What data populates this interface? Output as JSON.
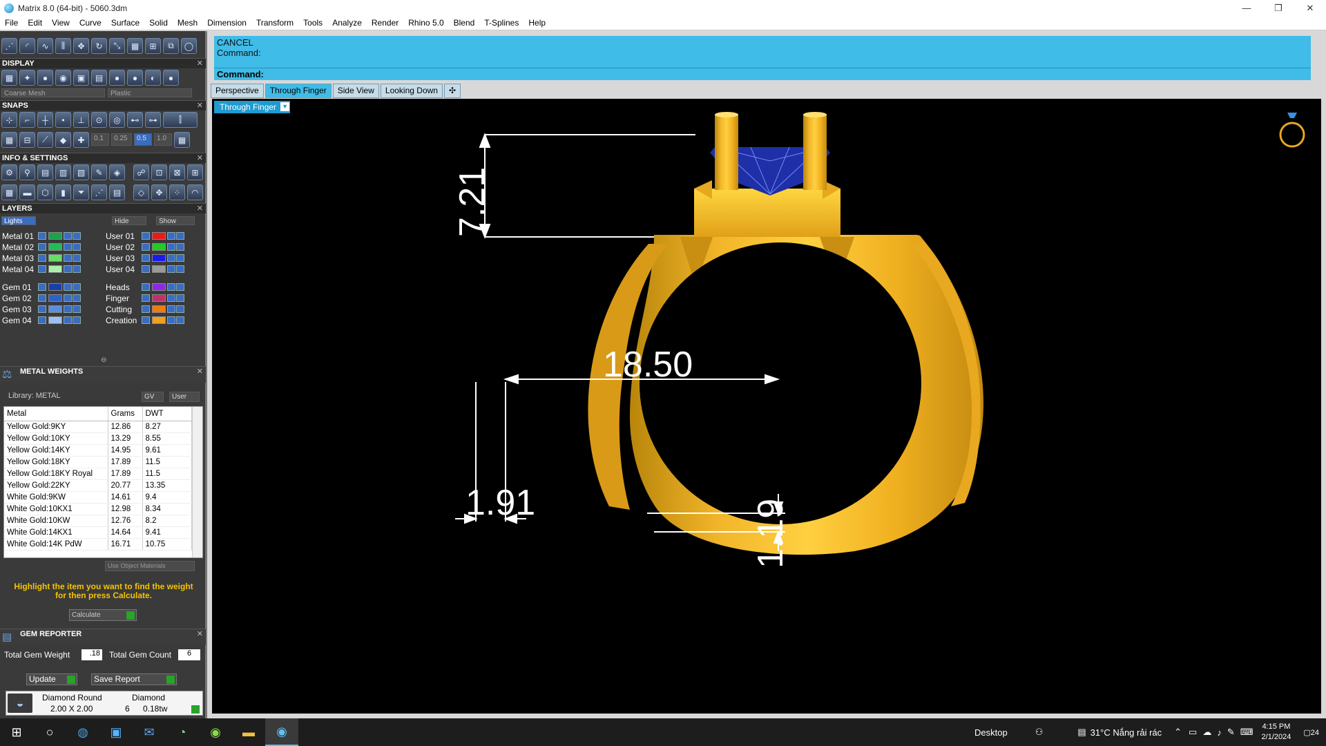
{
  "window": {
    "title": "Matrix 8.0 (64-bit) - 5060.3dm",
    "controls": [
      "—",
      "❐",
      "✕"
    ]
  },
  "menu": [
    "File",
    "Edit",
    "View",
    "Curve",
    "Surface",
    "Solid",
    "Mesh",
    "Dimension",
    "Transform",
    "Tools",
    "Analyze",
    "Render",
    "Rhino 5.0",
    "Blend",
    "T-Splines",
    "Help"
  ],
  "display": {
    "header": "DISPLAY",
    "mesh_select": "Coarse Mesh",
    "material_select": "Plastic"
  },
  "snaps": {
    "header": "SNAPS",
    "values": [
      "0.1",
      "0.25",
      "0.5",
      "1.0"
    ]
  },
  "info": {
    "header": "INFO & SETTINGS"
  },
  "layers": {
    "header": "LAYERS",
    "lights": "Lights",
    "hide": "Hide",
    "show": "Show",
    "left": [
      {
        "name": "Metal 01",
        "color": "#1aa34a"
      },
      {
        "name": "Metal 02",
        "color": "#22bb55"
      },
      {
        "name": "Metal 03",
        "color": "#66dd66"
      },
      {
        "name": "Metal 04",
        "color": "#aaf0aa"
      },
      {
        "name": "Gem 01",
        "color": "#1a3fa8"
      },
      {
        "name": "Gem 02",
        "color": "#2f62c9"
      },
      {
        "name": "Gem 03",
        "color": "#5a8fe0"
      },
      {
        "name": "Gem 04",
        "color": "#9ec0f0"
      }
    ],
    "right": [
      {
        "name": "User 01",
        "color": "#e61b1b"
      },
      {
        "name": "User 02",
        "color": "#22cc22"
      },
      {
        "name": "User 03",
        "color": "#1a1aee"
      },
      {
        "name": "User 04",
        "color": "#9a9a9a"
      },
      {
        "name": "Heads",
        "color": "#8a2be2"
      },
      {
        "name": "Finger",
        "color": "#c0306a"
      },
      {
        "name": "Cutting",
        "color": "#f07a10"
      },
      {
        "name": "Creation",
        "color": "#f0a020"
      }
    ]
  },
  "weights": {
    "header": "METAL WEIGHTS",
    "library": "Library: METAL",
    "gv": "GV",
    "user": "User",
    "columns": [
      "Metal",
      "Grams",
      "DWT"
    ],
    "rows": [
      [
        "Yellow Gold:9KY",
        "12.86",
        "8.27"
      ],
      [
        "Yellow Gold:10KY",
        "13.29",
        "8.55"
      ],
      [
        "Yellow Gold:14KY",
        "14.95",
        "9.61"
      ],
      [
        "Yellow Gold:18KY",
        "17.89",
        "11.5"
      ],
      [
        "Yellow Gold:18KY Royal",
        "17.89",
        "11.5"
      ],
      [
        "Yellow Gold:22KY",
        "20.77",
        "13.35"
      ],
      [
        "White Gold:9KW",
        "14.61",
        "9.4"
      ],
      [
        "White Gold:10KX1",
        "12.98",
        "8.34"
      ],
      [
        "White Gold:10KW",
        "12.76",
        "8.2"
      ],
      [
        "White Gold:14KX1",
        "14.64",
        "9.41"
      ],
      [
        "White Gold:14K PdW",
        "16.71",
        "10.75"
      ]
    ],
    "use_object": "Use Object Materials",
    "hint": "Highlight the item you want to find the weight for then press Calculate.",
    "calculate": "Calculate"
  },
  "gems": {
    "header": "GEM REPORTER",
    "total_weight_label": "Total Gem Weight",
    "total_weight": ".18",
    "total_count_label": "Total Gem Count",
    "total_count": "6",
    "update": "Update",
    "save": "Save Report",
    "shape": "Diamond Round",
    "size": "2.00 X 2.00",
    "type": "Diamond",
    "count": "6",
    "tw": "0.18tw"
  },
  "command": {
    "line1": "CANCEL",
    "line2": "Command:",
    "prompt": "Command:"
  },
  "tabs": [
    "Perspective",
    "Through Finger",
    "Side View",
    "Looking Down",
    "✣"
  ],
  "active_tab": "Through Finger",
  "viewport": {
    "label": "Through Finger",
    "dims": {
      "height": "7.21",
      "diameter": "18.50",
      "bottom_left": "1.91",
      "bottom_right": "1.19"
    }
  },
  "taskbar": {
    "desktop": "Desktop",
    "weather": "31°C  Nắng rải rác",
    "time": "4:15 PM",
    "date": "2/1/2024",
    "notif": "24"
  }
}
